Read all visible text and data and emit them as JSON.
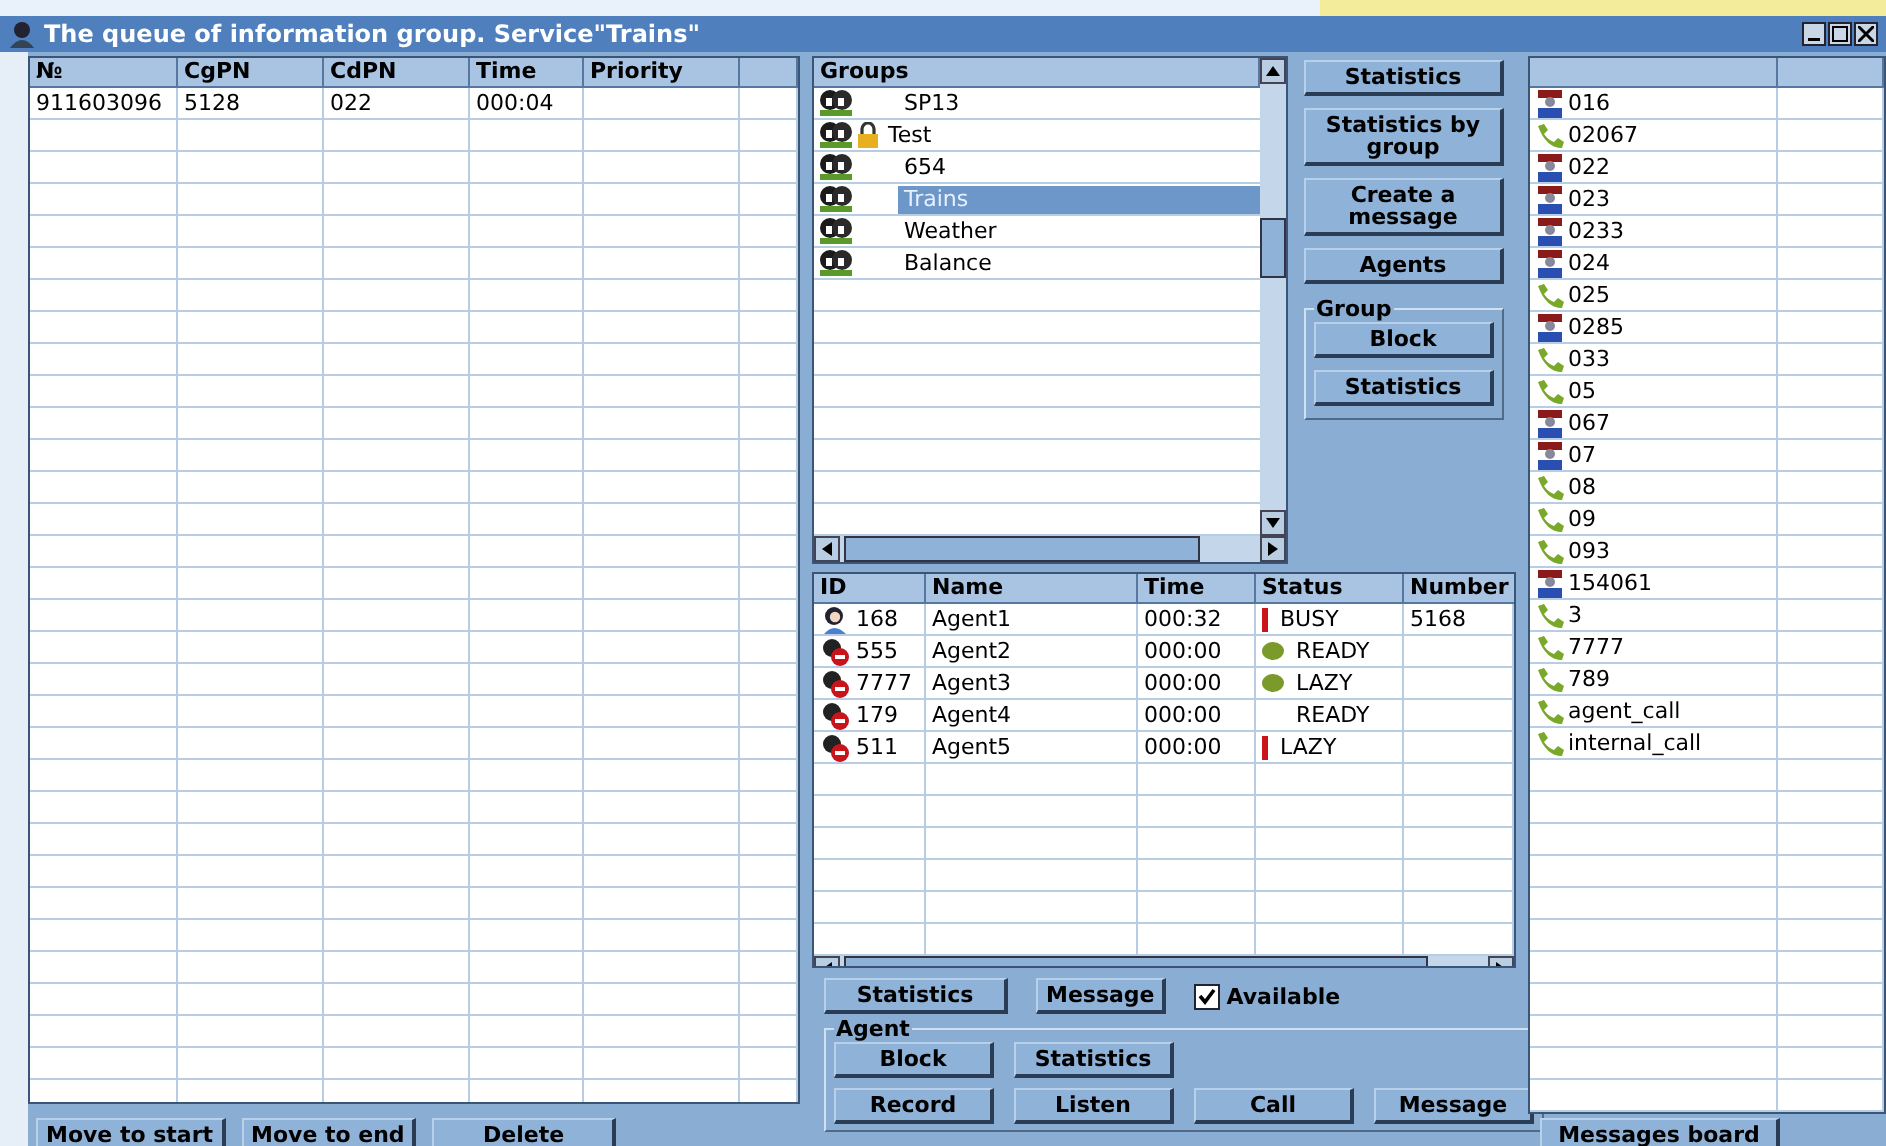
{
  "window": {
    "title": "The queue of information group. Service\"Trains\""
  },
  "queue": {
    "columns": [
      "№",
      "CgPN",
      "CdPN",
      "Time",
      "Priority"
    ],
    "rows": [
      {
        "no": "911603096",
        "cgpn": "5128",
        "cdpn": "022",
        "time": "000:04"
      }
    ],
    "buttons": [
      "Move to start",
      "Move to end",
      "Delete"
    ]
  },
  "groups": {
    "heading": "Groups",
    "items": [
      {
        "name": "SP13",
        "selected": false,
        "locked": false
      },
      {
        "name": "Test",
        "selected": false,
        "locked": true
      },
      {
        "name": "654",
        "selected": false,
        "locked": false
      },
      {
        "name": "Trains",
        "selected": true,
        "locked": false
      },
      {
        "name": "Weather",
        "selected": false,
        "locked": false
      },
      {
        "name": "Balance",
        "selected": false,
        "locked": false
      }
    ]
  },
  "side_buttons": [
    "Statistics",
    "Statistics by group",
    "Create a message",
    "Agents"
  ],
  "group_box": {
    "title": "Group",
    "buttons": [
      "Block",
      "Statistics"
    ]
  },
  "agents": {
    "columns": [
      "ID",
      "Name",
      "Time",
      "Status",
      "Number"
    ],
    "rows": [
      {
        "id": "168",
        "name": "Agent1",
        "time": "000:32",
        "status": "BUSY",
        "kind": "alert",
        "number": "5168",
        "blocked": false
      },
      {
        "id": "555",
        "name": "Agent2",
        "time": "000:00",
        "status": "READY",
        "kind": "dot",
        "blocked": true
      },
      {
        "id": "7777",
        "name": "Agent3",
        "time": "000:00",
        "status": "LAZY",
        "kind": "dot",
        "blocked": true
      },
      {
        "id": "179",
        "name": "Agent4",
        "time": "000:00",
        "status": "READY",
        "blocked": true
      },
      {
        "id": "511",
        "name": "Agent5",
        "time": "000:00",
        "status": "LAZY",
        "kind": "alert",
        "blocked": true
      }
    ]
  },
  "agent_actions": {
    "buttons": [
      "Statistics",
      "Message"
    ],
    "available": {
      "label": "Available",
      "checked": true
    }
  },
  "agent_box": {
    "title": "Agent",
    "buttons": [
      [
        "Block",
        "Statistics"
      ],
      [
        "Record",
        "Listen",
        "Call",
        "Message"
      ]
    ]
  },
  "services": {
    "items": [
      {
        "name": "016",
        "kind": "operator"
      },
      {
        "name": "02067",
        "kind": "phone"
      },
      {
        "name": "022",
        "kind": "operator"
      },
      {
        "name": "023",
        "kind": "operator"
      },
      {
        "name": "0233",
        "kind": "operator"
      },
      {
        "name": "024",
        "kind": "operator"
      },
      {
        "name": "025",
        "kind": "phone"
      },
      {
        "name": "0285",
        "kind": "operator"
      },
      {
        "name": "033",
        "kind": "phone"
      },
      {
        "name": "05",
        "kind": "phone"
      },
      {
        "name": "067",
        "kind": "operator"
      },
      {
        "name": "07",
        "kind": "operator"
      },
      {
        "name": "08",
        "kind": "phone"
      },
      {
        "name": "09",
        "kind": "phone"
      },
      {
        "name": "093",
        "kind": "phone"
      },
      {
        "name": "154061",
        "kind": "operator"
      },
      {
        "name": "3",
        "kind": "phone"
      },
      {
        "name": "7777",
        "kind": "phone"
      },
      {
        "name": "789",
        "kind": "phone"
      },
      {
        "name": "agent_call",
        "kind": "phone"
      },
      {
        "name": "internal_call",
        "kind": "phone"
      }
    ],
    "button": "Messages board"
  }
}
